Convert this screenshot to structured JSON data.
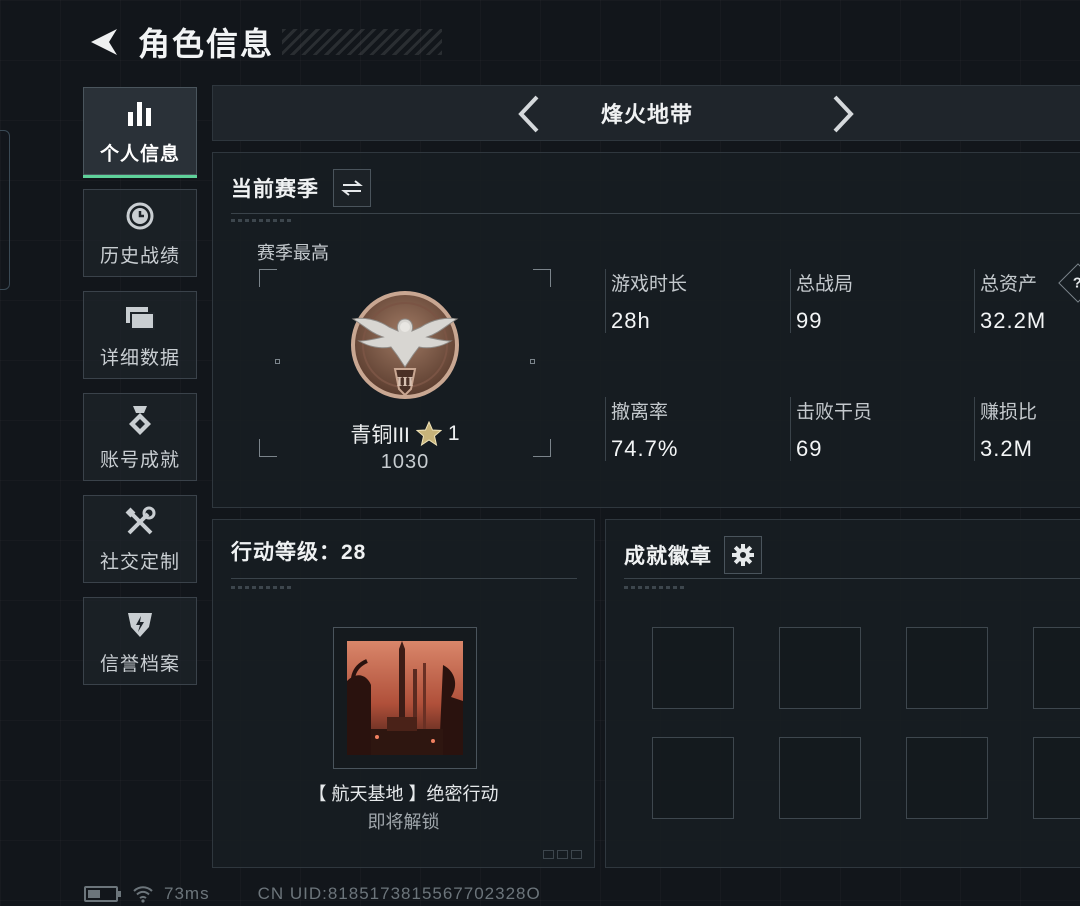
{
  "header": {
    "title": "角色信息"
  },
  "sidebar": {
    "items": [
      {
        "label": "个人信息",
        "icon": "bar-chart-icon",
        "active": true
      },
      {
        "label": "历史战绩",
        "icon": "history-clock-icon",
        "active": false
      },
      {
        "label": "详细数据",
        "icon": "folders-icon",
        "active": false
      },
      {
        "label": "账号成就",
        "icon": "medal-icon",
        "active": false
      },
      {
        "label": "社交定制",
        "icon": "tools-icon",
        "active": false
      },
      {
        "label": "信誉档案",
        "icon": "shield-bolt-icon",
        "active": false
      }
    ]
  },
  "mode": {
    "title": "烽火地带"
  },
  "season": {
    "title": "当前赛季",
    "best_label": "赛季最高",
    "rank_name": "青铜III",
    "rank_stars": "1",
    "rank_score": "1030",
    "stats": [
      {
        "label": "游戏时长",
        "value": "28h"
      },
      {
        "label": "总战局",
        "value": "99"
      },
      {
        "label": "总资产",
        "value": "32.2M",
        "help": "?"
      },
      {
        "label": "撤离率",
        "value": "74.7%"
      },
      {
        "label": "击败干员",
        "value": "69"
      },
      {
        "label": "赚损比",
        "value": "3.2M"
      }
    ]
  },
  "action": {
    "title": "行动等级：28",
    "mission_name": "【 航天基地 】绝密行动",
    "mission_status": "即将解锁"
  },
  "achievements": {
    "title": "成就徽章"
  },
  "status": {
    "ping": "73ms",
    "uid": "CN UID:8185173815567702328O",
    "battery_level": 0.45
  },
  "colors": {
    "accent": "#5ed19a",
    "background": "#12161b",
    "panel": "#181d22"
  }
}
